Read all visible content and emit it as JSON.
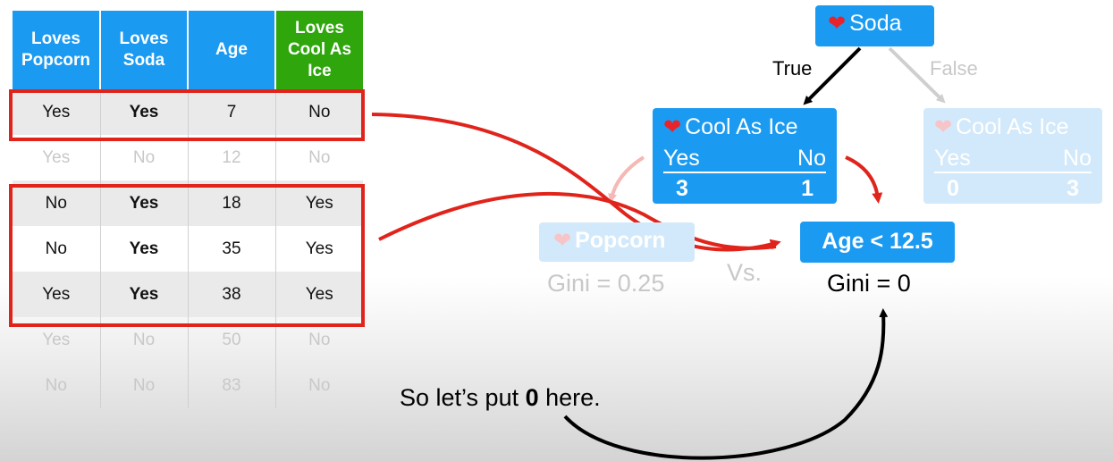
{
  "table": {
    "headers": [
      {
        "line1": "Loves",
        "line2": "Popcorn",
        "line3": ""
      },
      {
        "line1": "Loves",
        "line2": "Soda",
        "line3": ""
      },
      {
        "line1": "Age",
        "line2": "",
        "line3": ""
      },
      {
        "line1": "Loves",
        "line2": "Cool As",
        "line3": "Ice"
      }
    ],
    "rows": [
      [
        "Yes",
        "Yes",
        "7",
        "No"
      ],
      [
        "Yes",
        "No",
        "12",
        "No"
      ],
      [
        "No",
        "Yes",
        "18",
        "Yes"
      ],
      [
        "No",
        "Yes",
        "35",
        "Yes"
      ],
      [
        "Yes",
        "Yes",
        "38",
        "Yes"
      ],
      [
        "Yes",
        "No",
        "50",
        "No"
      ],
      [
        "No",
        "No",
        "83",
        "No"
      ]
    ]
  },
  "tree": {
    "root": {
      "label": "Soda"
    },
    "true_label": "True",
    "false_label": "False",
    "left_leaf": {
      "title": "Cool As Ice",
      "yes_label": "Yes",
      "no_label": "No",
      "yes_count": "3",
      "no_count": "1"
    },
    "right_leaf": {
      "title": "Cool As Ice",
      "yes_label": "Yes",
      "no_label": "No",
      "yes_count": "0",
      "no_count": "3"
    },
    "popcorn_node": {
      "label": "Popcorn",
      "gini": "Gini = 0.25"
    },
    "age_node": {
      "label": "Age < 12.5",
      "gini": "Gini = 0"
    },
    "versus": "Vs."
  },
  "caption": {
    "before": "So let’s put ",
    "bold": "0",
    "after": " here."
  },
  "colors": {
    "node_blue": "#1b9af1",
    "target_green": "#2ea60c",
    "highlight_red": "#e0241b",
    "heart_red": "#e8232a"
  }
}
